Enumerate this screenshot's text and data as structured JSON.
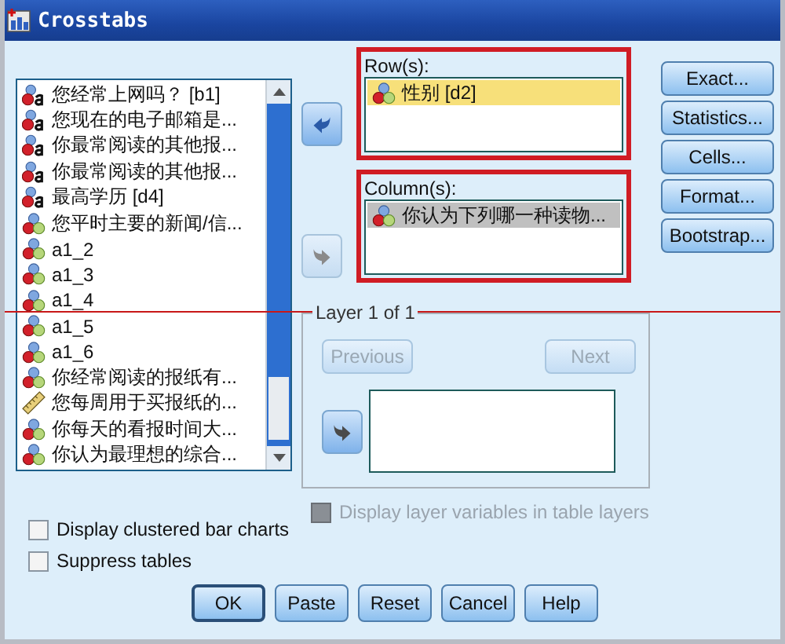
{
  "window": {
    "title": "Crosstabs"
  },
  "variables": [
    {
      "label": "您经常上网吗？ [b1]",
      "kind": "string"
    },
    {
      "label": "您现在的电子邮箱是...",
      "kind": "string"
    },
    {
      "label": "你最常阅读的其他报...",
      "kind": "string"
    },
    {
      "label": "你最常阅读的其他报...",
      "kind": "string"
    },
    {
      "label": "最高学历 [d4]",
      "kind": "string"
    },
    {
      "label": "您平时主要的新闻/信...",
      "kind": "nominal"
    },
    {
      "label": "a1_2",
      "kind": "nominal"
    },
    {
      "label": "a1_3",
      "kind": "nominal"
    },
    {
      "label": "a1_4",
      "kind": "nominal"
    },
    {
      "label": "a1_5",
      "kind": "nominal"
    },
    {
      "label": "a1_6",
      "kind": "nominal"
    },
    {
      "label": "你经常阅读的报纸有...",
      "kind": "nominal"
    },
    {
      "label": "您每周用于买报纸的...",
      "kind": "scale"
    },
    {
      "label": "你每天的看报时间大...",
      "kind": "nominal"
    },
    {
      "label": "你认为最理想的综合...",
      "kind": "nominal"
    }
  ],
  "targets": [
    {
      "label": "Row(s):",
      "highlighted": true,
      "move_button": {
        "kind": "left",
        "disabled": false
      },
      "items": [
        {
          "label": "性别 [d2]",
          "kind": "nominal",
          "focused": true
        }
      ]
    },
    {
      "label": "Column(s):",
      "highlighted": true,
      "move_button": {
        "kind": "right",
        "disabled": true
      },
      "items": [
        {
          "label": "你认为下列哪一种读物...",
          "kind": "nominal",
          "focused": false
        }
      ]
    }
  ],
  "layer": {
    "title": "Layer 1 of 1",
    "previous": {
      "label": "Previous",
      "disabled": true
    },
    "next": {
      "label": "Next",
      "disabled": true
    },
    "move_button": {
      "kind": "right",
      "disabled": false
    }
  },
  "display_layer": {
    "label": "Display layer variables in table layers",
    "checked": false,
    "disabled": true
  },
  "side_buttons": [
    {
      "label": "Exact..."
    },
    {
      "label": "Statistics..."
    },
    {
      "label": "Cells..."
    },
    {
      "label": "Format..."
    },
    {
      "label": "Bootstrap..."
    }
  ],
  "options": [
    {
      "label": "Display clustered bar charts",
      "checked": false
    },
    {
      "label": "Suppress tables",
      "checked": false
    }
  ],
  "buttons": [
    {
      "label": "OK",
      "default": true
    },
    {
      "label": "Paste",
      "default": false
    },
    {
      "label": "Reset",
      "default": false
    },
    {
      "label": "Cancel",
      "default": false
    },
    {
      "label": "Help",
      "default": false
    }
  ]
}
